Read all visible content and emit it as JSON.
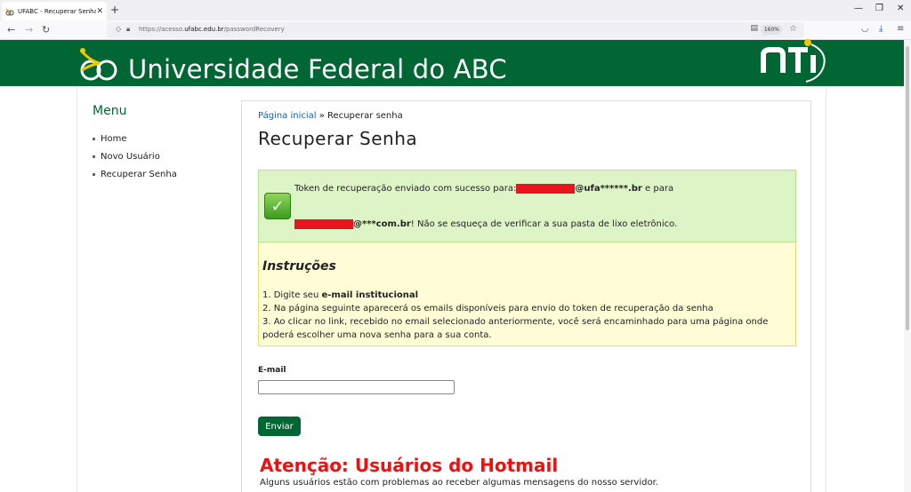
{
  "browser": {
    "tab_title": "UFABC - Recuperar Senha",
    "tab_close": "✕",
    "new_tab": "+",
    "url_prefix": "https://acesso.",
    "url_domain": "ufabc.edu.br",
    "url_path": "/passwordRecovery",
    "zoom": "160%"
  },
  "header": {
    "university_name": "Universidade Federal do ABC",
    "brand_color": "#006633"
  },
  "menu": {
    "title": "Menu",
    "items": [
      {
        "label": "Home"
      },
      {
        "label": "Novo Usuário"
      },
      {
        "label": "Recuperar Senha"
      }
    ]
  },
  "breadcrumb": {
    "home_link": "Página inicial",
    "separator": " » ",
    "current": "Recuperar senha"
  },
  "page_title": "Recuperar Senha",
  "success": {
    "line1_prefix": "Token de recuperação enviado com sucesso para: ",
    "email1_suffix": "@ufa******.br",
    "line1_end": " e para",
    "email2_suffix": "@***com.br",
    "line2_end": "! Não se esqueça de verificar a sua pasta de lixo eletrônico."
  },
  "instructions": {
    "title": "Instruções",
    "item1_prefix": "1. Digite seu ",
    "item1_bold": "e-mail institucional",
    "item2": "2. Na página seguinte aparecerá os emails disponíveis para envio do token de recuperação da senha",
    "item3": "3. Ao clicar no link, recebido no email selecionado anteriormente, você será encaminhado para uma página onde poderá escolher uma nova senha para a sua conta."
  },
  "form": {
    "email_label": "E-mail",
    "email_value": "",
    "submit_label": "Enviar"
  },
  "warning": {
    "title": "Atenção: Usuários do Hotmail",
    "text": "Alguns usuários estão com problemas ao receber algumas mensagens do nosso servidor.",
    "color": "#ee1111"
  }
}
